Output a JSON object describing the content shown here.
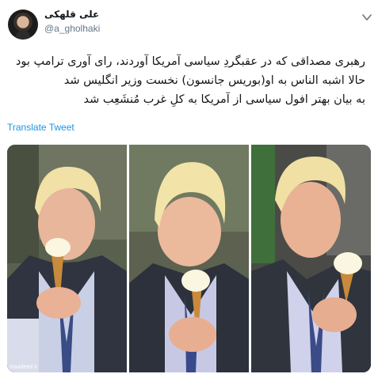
{
  "tweet": {
    "author": {
      "display_name": "علی قلهکی",
      "handle": "@a_gholhaki"
    },
    "body_lines": [
      "رهبری مصداقی که در عقبگردِ سیاسی آمریکا آوردند، رای آوری ترامپ بود",
      "حالا اشبه الناس به او(بوریس جانسون) نخست وزیر انگلیس شد",
      "به بیان بهتر افول سیاسی از آمریکا به کلِ غرب مُنشَعِب شد"
    ],
    "translate_label": "Translate Tweet",
    "media": {
      "photos": [
        "photo-1",
        "photo-2",
        "photo-3"
      ],
      "watermark": "maadeed.ir"
    }
  },
  "colors": {
    "link": "#1b95e0",
    "secondary_text": "#657786",
    "primary_text": "#14171a"
  },
  "icons": {
    "menu": "chevron-down-icon"
  }
}
